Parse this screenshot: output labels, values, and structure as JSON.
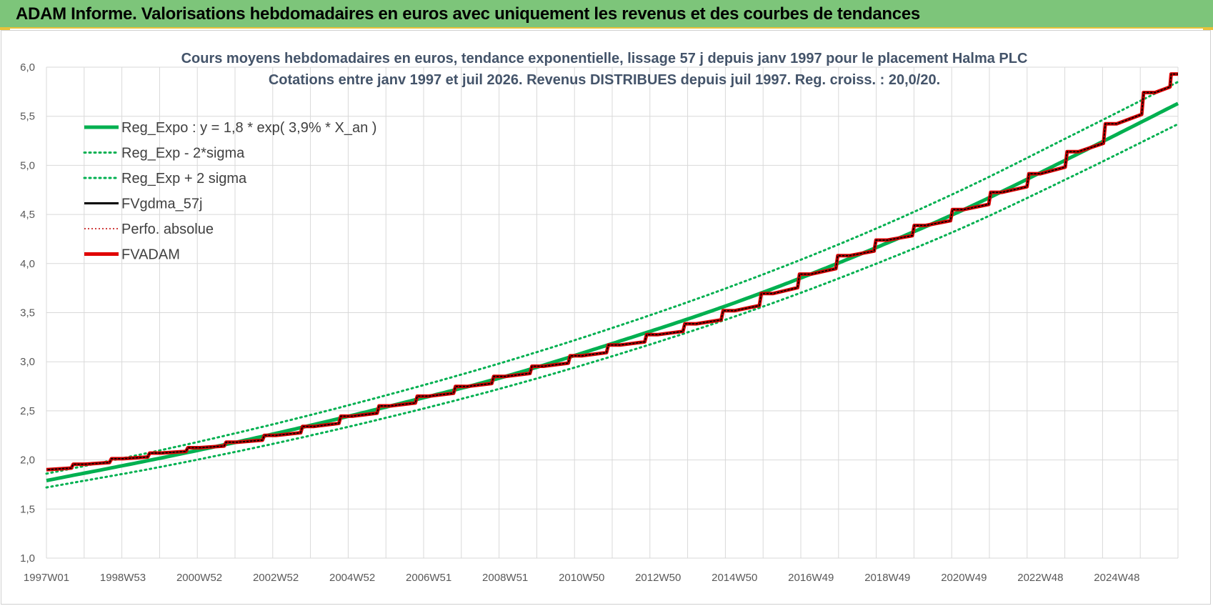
{
  "header": {
    "title": "ADAM Informe. Valorisations hebdomadaires en euros avec uniquement les revenus et des courbes de tendances"
  },
  "colors": {
    "header_bg": "#7dc57a",
    "accent_yellow": "#e8c23a",
    "green": "#00b050",
    "black": "#000000",
    "red": "#e00000",
    "dark_red": "#c00000",
    "title_text": "#44546a"
  },
  "chart_data": {
    "type": "line",
    "title": "Cours moyens hebdomadaires en euros, tendance exponentielle, lissage 57 j depuis janv 1997 pour le placement Halma PLC",
    "subtitle": "Cotations entre janv 1997 et juil 2026. Revenus DISTRIBUES depuis juil 1997. Reg. croiss. : 20,0/20.",
    "xlabel": "",
    "ylabel": "",
    "ylim": [
      1.0,
      6.0
    ],
    "xlim": [
      1997.0,
      2026.6
    ],
    "grid": true,
    "legend_placement": "top-left",
    "y_ticks": [
      "1,0",
      "1,5",
      "2,0",
      "2,5",
      "3,0",
      "3,5",
      "4,0",
      "4,5",
      "5,0",
      "5,5",
      "6,0"
    ],
    "x_tick_labels": [
      "1997W01",
      "1998W53",
      "2000W52",
      "2002W52",
      "2004W52",
      "2006W51",
      "2008W51",
      "2010W50",
      "2012W50",
      "2014W50",
      "2016W49",
      "2018W49",
      "2020W49",
      "2022W48",
      "2024W48"
    ],
    "x": [
      1997.0,
      2000.0,
      2003.0,
      2006.0,
      2009.0,
      2012.0,
      2015.0,
      2018.0,
      2021.0,
      2024.0,
      2026.6
    ],
    "series": [
      {
        "name": "Reg_Expo : y = 1,8 * exp( 3,9% *  X_an )",
        "style": "solid-thick",
        "color": "#00b050",
        "values": [
          1.79,
          2.02,
          2.27,
          2.55,
          2.85,
          3.21,
          3.6,
          4.05,
          4.55,
          5.12,
          5.63
        ]
      },
      {
        "name": "Reg_Exp - 2*sigma",
        "style": "dotted",
        "color": "#00b050",
        "values": [
          1.72,
          1.93,
          2.17,
          2.44,
          2.74,
          3.08,
          3.46,
          3.89,
          4.37,
          4.92,
          5.42
        ]
      },
      {
        "name": "Reg_Exp + 2 sigma",
        "style": "dotted",
        "color": "#00b050",
        "values": [
          1.86,
          2.1,
          2.37,
          2.67,
          3.0,
          3.37,
          3.78,
          4.24,
          4.76,
          5.34,
          5.85
        ]
      },
      {
        "name": "FVgdma_57j",
        "style": "solid",
        "color": "#000000",
        "values": [
          1.9,
          2.07,
          2.25,
          2.55,
          2.85,
          3.17,
          3.52,
          4.08,
          4.55,
          5.14,
          5.93
        ]
      },
      {
        "name": "Perfo. absolue",
        "style": "dotted-thin",
        "color": "#c00000",
        "values": [
          1.9,
          2.07,
          2.25,
          2.55,
          2.85,
          3.17,
          3.52,
          4.08,
          4.55,
          5.14,
          5.93
        ]
      },
      {
        "name": "FVADAM",
        "style": "solid-thick-stepped",
        "color": "#e00000",
        "values": [
          1.9,
          2.07,
          2.25,
          2.55,
          2.85,
          3.17,
          3.52,
          4.08,
          4.55,
          5.14,
          5.93
        ]
      }
    ]
  }
}
